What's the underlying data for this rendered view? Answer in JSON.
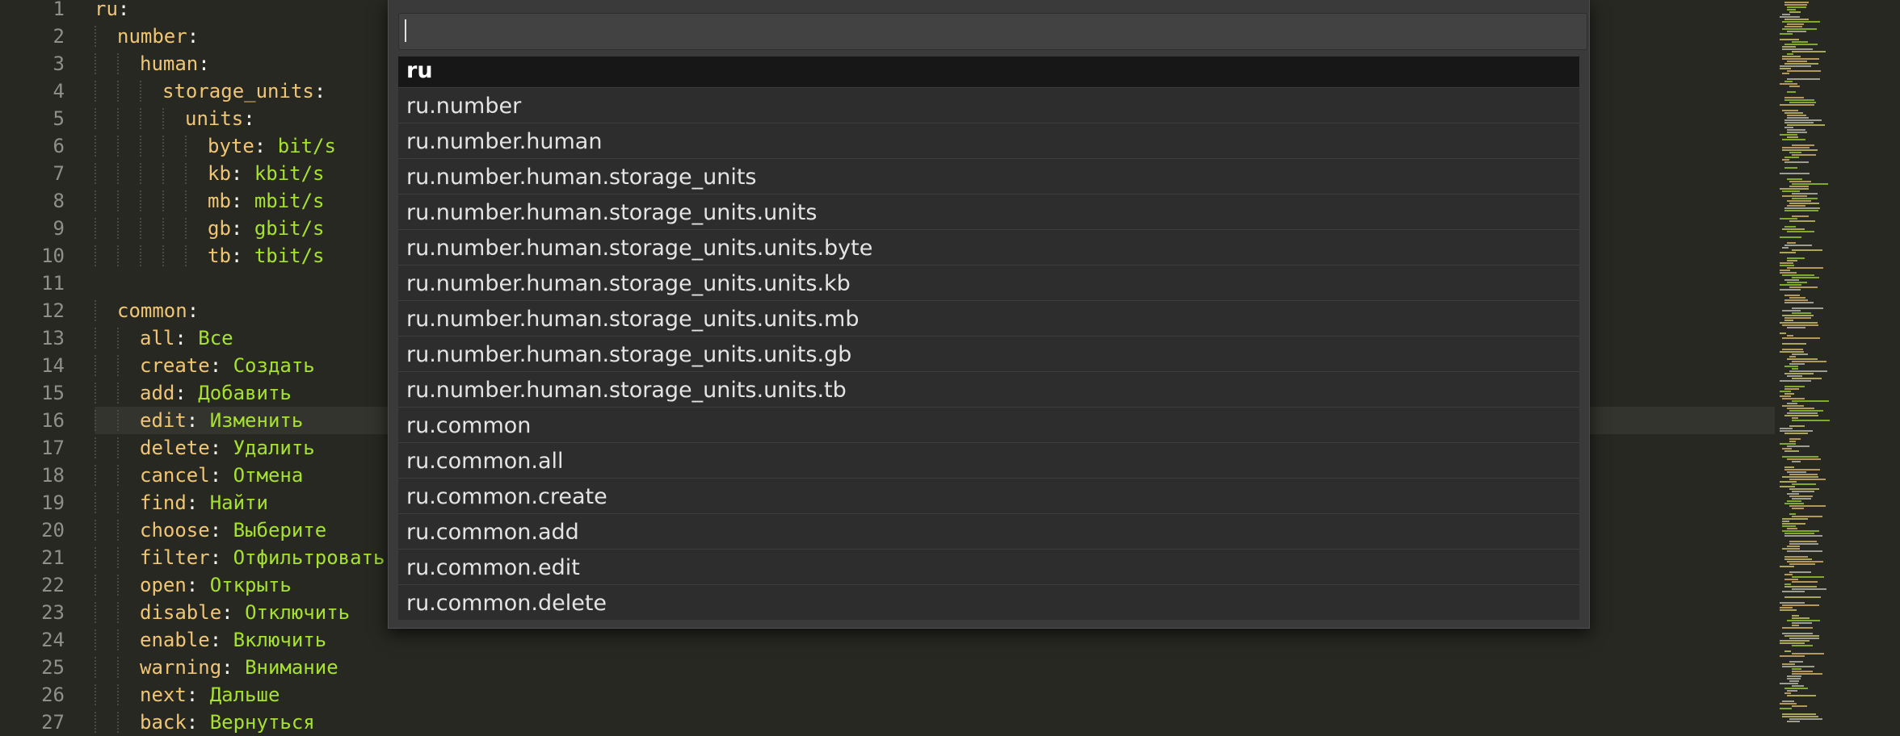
{
  "editor": {
    "current_line": 16,
    "lines": [
      {
        "n": "1",
        "indent": 0,
        "key": "ru",
        "value": ""
      },
      {
        "n": "2",
        "indent": 1,
        "key": "number",
        "value": ""
      },
      {
        "n": "3",
        "indent": 2,
        "key": "human",
        "value": ""
      },
      {
        "n": "4",
        "indent": 3,
        "key": "storage_units",
        "value": ""
      },
      {
        "n": "5",
        "indent": 4,
        "key": "units",
        "value": ""
      },
      {
        "n": "6",
        "indent": 5,
        "key": "byte",
        "value": "bit/s"
      },
      {
        "n": "7",
        "indent": 5,
        "key": "kb",
        "value": "kbit/s"
      },
      {
        "n": "8",
        "indent": 5,
        "key": "mb",
        "value": "mbit/s"
      },
      {
        "n": "9",
        "indent": 5,
        "key": "gb",
        "value": "gbit/s"
      },
      {
        "n": "10",
        "indent": 5,
        "key": "tb",
        "value": "tbit/s"
      },
      {
        "n": "11",
        "indent": 0,
        "key": "",
        "value": ""
      },
      {
        "n": "12",
        "indent": 1,
        "key": "common",
        "value": ""
      },
      {
        "n": "13",
        "indent": 2,
        "key": "all",
        "value": "Все"
      },
      {
        "n": "14",
        "indent": 2,
        "key": "create",
        "value": "Создать"
      },
      {
        "n": "15",
        "indent": 2,
        "key": "add",
        "value": "Добавить"
      },
      {
        "n": "16",
        "indent": 2,
        "key": "edit",
        "value": "Изменить"
      },
      {
        "n": "17",
        "indent": 2,
        "key": "delete",
        "value": "Удалить"
      },
      {
        "n": "18",
        "indent": 2,
        "key": "cancel",
        "value": "Отмена"
      },
      {
        "n": "19",
        "indent": 2,
        "key": "find",
        "value": "Найти"
      },
      {
        "n": "20",
        "indent": 2,
        "key": "choose",
        "value": "Выберите"
      },
      {
        "n": "21",
        "indent": 2,
        "key": "filter",
        "value": "Отфильтровать"
      },
      {
        "n": "22",
        "indent": 2,
        "key": "open",
        "value": "Открыть"
      },
      {
        "n": "23",
        "indent": 2,
        "key": "disable",
        "value": "Отключить"
      },
      {
        "n": "24",
        "indent": 2,
        "key": "enable",
        "value": "Включить"
      },
      {
        "n": "25",
        "indent": 2,
        "key": "warning",
        "value": "Внимание"
      },
      {
        "n": "26",
        "indent": 2,
        "key": "next",
        "value": "Дальше"
      },
      {
        "n": "27",
        "indent": 2,
        "key": "back",
        "value": "Вернуться"
      }
    ]
  },
  "palette": {
    "query": "",
    "selected_index": 0,
    "results": [
      "ru",
      "ru.number",
      "ru.number.human",
      "ru.number.human.storage_units",
      "ru.number.human.storage_units.units",
      "ru.number.human.storage_units.units.byte",
      "ru.number.human.storage_units.units.kb",
      "ru.number.human.storage_units.units.mb",
      "ru.number.human.storage_units.units.gb",
      "ru.number.human.storage_units.units.tb",
      "ru.common",
      "ru.common.all",
      "ru.common.create",
      "ru.common.add",
      "ru.common.edit",
      "ru.common.delete"
    ]
  },
  "colors": {
    "background": "#272822",
    "key": "#f0c674",
    "value": "#a6e22e",
    "line_number": "#8f908a",
    "selected_result": "#171717"
  }
}
